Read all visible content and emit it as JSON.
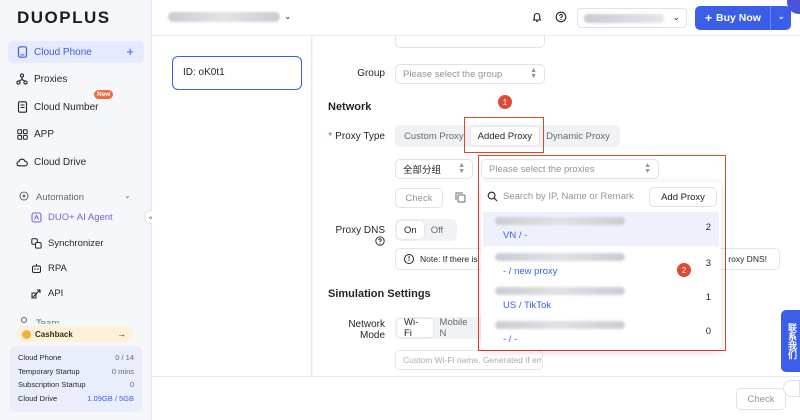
{
  "logo": "DUOPLUS",
  "sidebar": {
    "items": [
      {
        "label": "Cloud Phone",
        "icon": "phone-icon",
        "active": true
      },
      {
        "label": "Proxies",
        "icon": "proxies-icon"
      },
      {
        "label": "Cloud Number",
        "icon": "number-icon",
        "badge": "New"
      },
      {
        "label": "APP",
        "icon": "app-grid-icon"
      },
      {
        "label": "Cloud Drive",
        "icon": "cloud-icon"
      }
    ],
    "automation": {
      "label": "Automation",
      "items": [
        {
          "label": "DUO+ AI Agent",
          "icon": "ai-agent-icon"
        },
        {
          "label": "Synchronizer",
          "icon": "synchronizer-icon"
        },
        {
          "label": "RPA",
          "icon": "rpa-icon"
        },
        {
          "label": "API",
          "icon": "api-icon"
        }
      ]
    },
    "team_label": "Team",
    "cashback": "Cashback",
    "stats": [
      {
        "label": "Cloud Phone",
        "value": "0 / 14"
      },
      {
        "label": "Temporary Startup",
        "value": "0 mins"
      },
      {
        "label": "Subscription Startup",
        "value": "0"
      },
      {
        "label": "Cloud Drive",
        "value": "1.09GB / 5GB"
      }
    ]
  },
  "topbar": {
    "buy_now": "Buy Now"
  },
  "device": {
    "id": "ID: oK0t1"
  },
  "form": {
    "group_label": "Group",
    "group_placeholder": "Please select the group",
    "network_title": "Network",
    "proxy_type_label": "Proxy Type",
    "proxy_type_options": [
      "Custom Proxy",
      "Added Proxy",
      "Dynamic Proxy"
    ],
    "proxy_type_selected": "Added Proxy",
    "group_filter": "全部分组",
    "proxies_placeholder": "Please select the proxies",
    "check_label": "Check",
    "proxy_dns_label": "Proxy DNS",
    "dns_options": [
      "On",
      "Off"
    ],
    "dns_selected": "On",
    "note_text": "Note: If there is",
    "note_tail": "roxy DNS!",
    "simulation_title": "Simulation Settings",
    "network_mode_label": "Network Mode",
    "network_mode_options": [
      "Wi-Fi",
      "Mobile N"
    ],
    "network_mode_selected": "Wi-Fi",
    "wifi_placeholder": "Custom Wi-Fi name. Generated if empty"
  },
  "dropdown": {
    "search_placeholder": "Search by IP, Name or Remark",
    "add_proxy": "Add Proxy",
    "rows": [
      {
        "tag": "VN / -",
        "count": "2"
      },
      {
        "tag": "- / new proxy",
        "count": "3"
      },
      {
        "tag": "US / TikTok",
        "count": "1"
      },
      {
        "tag": "- / -",
        "count": "0"
      }
    ]
  },
  "annotations": [
    "1",
    "2"
  ],
  "footer": {
    "check": "Check"
  },
  "side_tab": "联系我们",
  "colors": {
    "primary": "#3b5ee8",
    "annotation_red": "#d9452f",
    "new_badge": "#f26b3a"
  }
}
